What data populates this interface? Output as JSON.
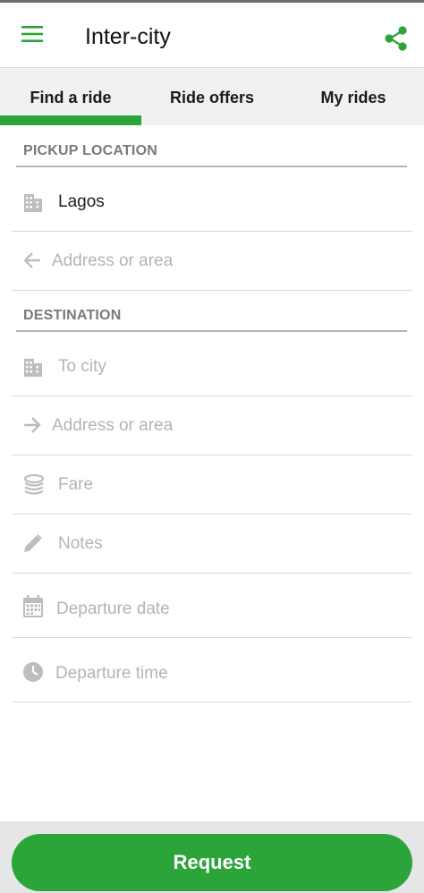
{
  "appbar": {
    "title": "Inter-city",
    "menu_icon": "hamburger-menu-icon",
    "share_icon": "share-icon"
  },
  "tabs": [
    {
      "label": "Find a ride",
      "active": true
    },
    {
      "label": "Ride offers",
      "active": false
    },
    {
      "label": "My rides",
      "active": false
    }
  ],
  "pickup": {
    "header": "PICKUP LOCATION",
    "city_value": "Lagos",
    "address_placeholder": "Address or area"
  },
  "destination": {
    "header": "DESTINATION",
    "city_placeholder": "To city",
    "address_placeholder": "Address or area"
  },
  "fields": {
    "fare_placeholder": "Fare",
    "notes_placeholder": "Notes",
    "date_placeholder": "Departure date",
    "time_placeholder": "Departure time"
  },
  "request_label": "Request",
  "colors": {
    "accent": "#2ba53a",
    "placeholder": "#b4b4b4",
    "icon": "#bdbdbd",
    "header": "#7a7a7a"
  }
}
